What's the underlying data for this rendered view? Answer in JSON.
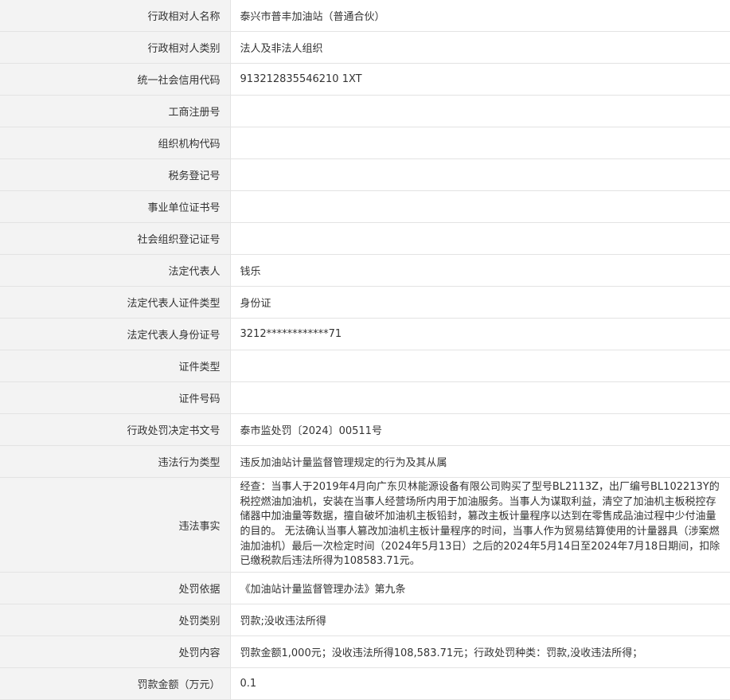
{
  "rows": [
    {
      "label": "行政相对人名称",
      "value": "泰兴市普丰加油站（普通合伙）"
    },
    {
      "label": "行政相对人类别",
      "value": "法人及非法人组织"
    },
    {
      "label": "统一社会信用代码",
      "value": "913212835546210 1XT"
    },
    {
      "label": "工商注册号",
      "value": ""
    },
    {
      "label": "组织机构代码",
      "value": ""
    },
    {
      "label": "税务登记号",
      "value": ""
    },
    {
      "label": "事业单位证书号",
      "value": ""
    },
    {
      "label": "社会组织登记证号",
      "value": ""
    },
    {
      "label": "法定代表人",
      "value": "钱乐"
    },
    {
      "label": "法定代表人证件类型",
      "value": "身份证"
    },
    {
      "label": "法定代表人身份证号",
      "value": "3212************71"
    },
    {
      "label": "证件类型",
      "value": ""
    },
    {
      "label": "证件号码",
      "value": ""
    },
    {
      "label": "行政处罚决定书文号",
      "value": "泰市监处罚〔2024〕00511号"
    },
    {
      "label": "违法行为类型",
      "value": "违反加油站计量监督管理规定的行为及其从属"
    },
    {
      "label": "违法事实",
      "value": "经查：当事人于2019年4月向广东贝林能源设备有限公司购买了型号BL2113Z，出厂编号BL102213Y的税控燃油加油机，安装在当事人经营场所内用于加油服务。当事人为谋取利益，清空了加油机主板税控存储器中加油量等数据，擅自破坏加油机主板铅封，篡改主板计量程序以达到在零售成品油过程中少付油量的目的。 无法确认当事人篡改加油机主板计量程序的时间，当事人作为贸易结算使用的计量器具（涉案燃油加油机）最后一次检定时间（2024年5月13日）之后的2024年5月14日至2024年7月18日期间，扣除已缴税款后违法所得为108583.71元。"
    },
    {
      "label": "处罚依据",
      "value": "《加油站计量监督管理办法》第九条"
    },
    {
      "label": "处罚类别",
      "value": "罚款;没收违法所得"
    },
    {
      "label": "处罚内容",
      "value": "罚款金额1,000元；没收违法所得108,583.71元；行政处罚种类：罚款,没收违法所得；"
    },
    {
      "label": "罚款金额（万元）",
      "value": "0.1"
    }
  ]
}
